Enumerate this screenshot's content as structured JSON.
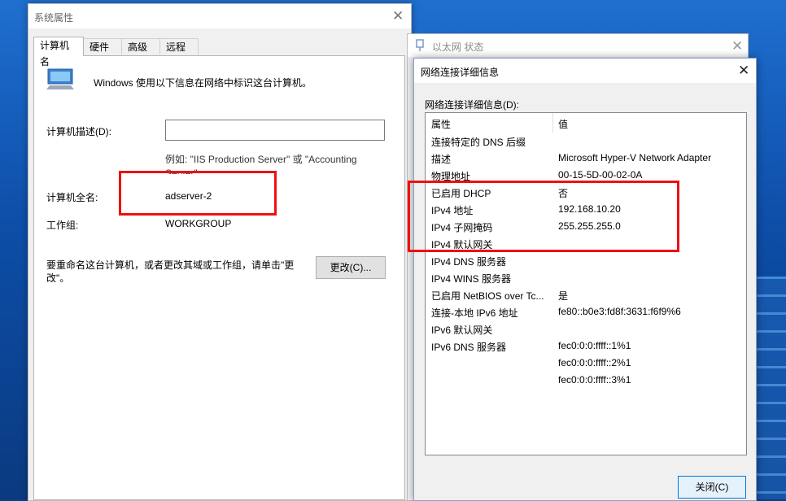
{
  "sysprops": {
    "title": "系统属性",
    "tabs": [
      "计算机名",
      "硬件",
      "高级",
      "远程"
    ],
    "intro": "Windows 使用以下信息在网络中标识这台计算机。",
    "desc_label": "计算机描述(D):",
    "desc_value": "",
    "example_line1": "例如: \"IIS Production Server\" 或 \"Accounting",
    "example_line2": "Server\"。",
    "fullname_label": "计算机全名:",
    "fullname_value": "adserver-2",
    "workgroup_label": "工作组:",
    "workgroup_value": "WORKGROUP",
    "rename_line1": "要重命名这台计算机，或者更改其域或工作组，请单击\"更",
    "rename_line2": "改\"。",
    "change_button": "更改(C)..."
  },
  "ethernet_status": {
    "title": "以太网 状态"
  },
  "netdetails": {
    "title": "网络连接详细信息",
    "list_label": "网络连接详细信息(D):",
    "col_property": "属性",
    "col_value": "值",
    "rows": [
      {
        "p": "连接特定的 DNS 后缀",
        "v": ""
      },
      {
        "p": "描述",
        "v": "Microsoft Hyper-V Network Adapter"
      },
      {
        "p": "物理地址",
        "v": "00-15-5D-00-02-0A"
      },
      {
        "p": "已启用 DHCP",
        "v": "否"
      },
      {
        "p": "IPv4 地址",
        "v": "192.168.10.20"
      },
      {
        "p": "IPv4 子网掩码",
        "v": "255.255.255.0"
      },
      {
        "p": "IPv4 默认网关",
        "v": ""
      },
      {
        "p": "IPv4 DNS 服务器",
        "v": ""
      },
      {
        "p": "IPv4 WINS 服务器",
        "v": ""
      },
      {
        "p": "已启用 NetBIOS over Tc...",
        "v": "是"
      },
      {
        "p": "连接-本地 IPv6 地址",
        "v": "fe80::b0e3:fd8f:3631:f6f9%6"
      },
      {
        "p": "IPv6 默认网关",
        "v": ""
      },
      {
        "p": "IPv6 DNS 服务器",
        "v": "fec0:0:0:ffff::1%1"
      },
      {
        "p": "",
        "v": "fec0:0:0:ffff::2%1"
      },
      {
        "p": "",
        "v": "fec0:0:0:ffff::3%1"
      }
    ],
    "close_button": "关闭(C)"
  },
  "colors": {
    "highlight": "#f01010",
    "accent": "#0078d7"
  }
}
